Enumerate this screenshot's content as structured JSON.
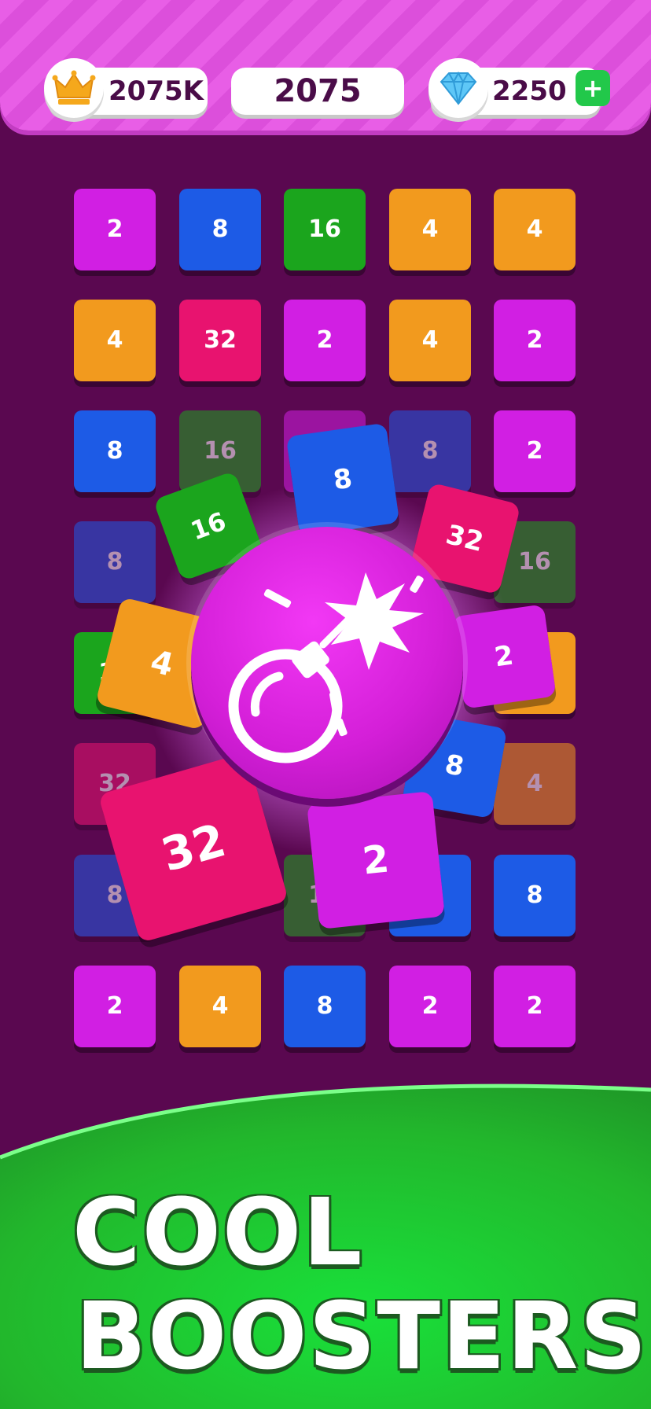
{
  "header": {
    "crown_value": "2075K",
    "score_value": "2075",
    "gem_value": "2250",
    "plus_label": "+"
  },
  "board": {
    "colors": {
      "2": "#d11fe3",
      "4": "#f29a1e",
      "8": "#1d5be6",
      "16": "#1ba51d",
      "32": "#e8136f"
    },
    "rows": [
      [
        "2",
        "8",
        "16",
        "4",
        "4"
      ],
      [
        "4",
        "32",
        "2",
        "4",
        "2"
      ],
      [
        "8",
        "16",
        "2",
        "8",
        "2"
      ],
      [
        "8",
        "",
        "",
        "",
        "16"
      ],
      [
        "16",
        "",
        "",
        "",
        "4"
      ],
      [
        "32",
        "",
        "",
        "",
        "4"
      ],
      [
        "8",
        "",
        "16",
        "8",
        "8"
      ],
      [
        "2",
        "4",
        "8",
        "2",
        "2"
      ]
    ]
  },
  "flying_tiles": [
    "8",
    "16",
    "32",
    "2",
    "4",
    "8",
    "32",
    "2"
  ],
  "banner": {
    "line1": "COOL",
    "line2": "BOOSTERS"
  }
}
